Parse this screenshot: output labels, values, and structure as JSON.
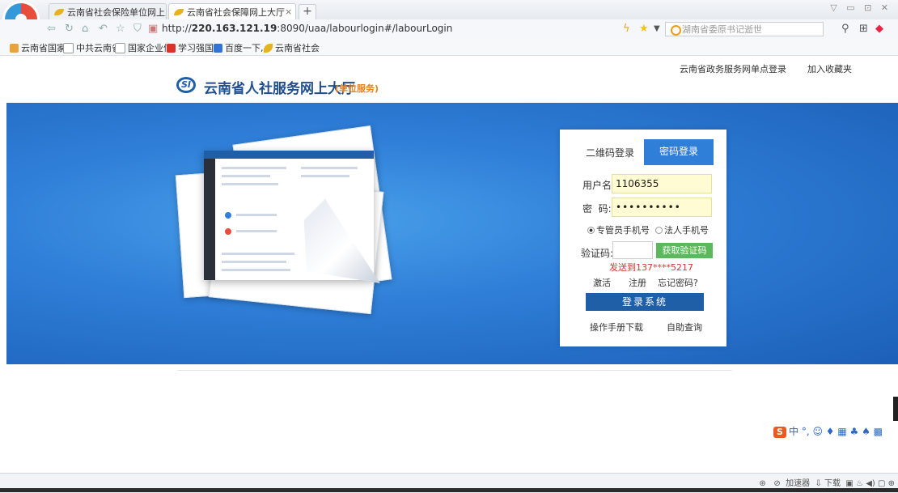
{
  "browser": {
    "tabs": [
      {
        "label": "云南省社会保险单位网上业务",
        "active": false
      },
      {
        "label": "云南省社会保障网上大厅",
        "active": true
      }
    ],
    "new_tab": "+",
    "url_prefix": "http://",
    "url_host": "220.163.121.19",
    "url_rest": ":8090/uaa/labourlogin#/labourLogin",
    "search_placeholder": "湖南省委原书记逝世",
    "bookmarks": [
      "云南省国家",
      "中共云南省",
      "国家企业信",
      "学习强国",
      "百度一下,",
      "云南省社会"
    ]
  },
  "header": {
    "gov_login": "云南省政务服务网单点登录",
    "add_favorite": "加入收藏夹",
    "logo_mark": "SI",
    "site_title": "云南省人社服务网上大厅",
    "site_subtitle": "(单位服务)"
  },
  "login": {
    "tab_qr": "二维码登录",
    "tab_password": "密码登录",
    "username_label": "用户名:",
    "username_value": "1106355",
    "password_label": "密  码:",
    "password_value": "••••••••••",
    "radio_manager": "专管员手机号",
    "radio_legal": "法人手机号",
    "code_label": "验证码:",
    "get_code": "获取验证码",
    "sent_note": "发送到137****5217",
    "activate": "激活",
    "register": "注册",
    "forgot": "忘记密码?",
    "login_button": "登录系统",
    "manual_download": "操作手册下载",
    "self_query": "自助查询"
  },
  "ime": {
    "icon": "S",
    "lang": "中"
  },
  "statusbar": {
    "accelerator": "加速器",
    "download": "下载"
  },
  "colors": {
    "banner_blue": "#2f7fd8",
    "primary_dark": "#1f5fa8",
    "success_green": "#5cb85c",
    "alert_red": "#d9342b",
    "subtitle_orange": "#e6821e"
  }
}
